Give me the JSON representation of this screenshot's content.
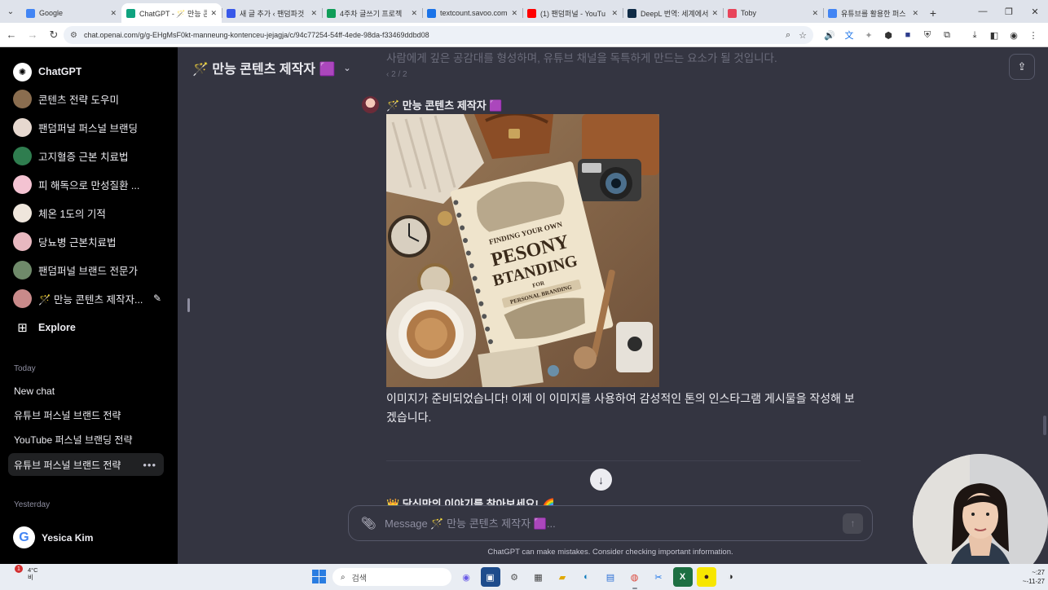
{
  "browser": {
    "tabs": [
      {
        "title": "Google",
        "icon": "google-favicon",
        "color": "#4285f4"
      },
      {
        "title": "ChatGPT - 🪄 만능 콘",
        "icon": "chatgpt-favicon",
        "color": "#10a37f",
        "active": true
      },
      {
        "title": "새 글 추가 ‹ 팬덤파것",
        "icon": "wordpress-favicon",
        "color": "#3858e9"
      },
      {
        "title": "4주차 글쓰기 프로젝",
        "icon": "sheets-favicon",
        "color": "#0f9d58"
      },
      {
        "title": "textcount.savoo.com",
        "icon": "textcount-favicon",
        "color": "#1a73e8"
      },
      {
        "title": "(1) 팬덤퍼널 - YouTu",
        "icon": "youtube-favicon",
        "color": "#ff0000"
      },
      {
        "title": "DeepL 번역: 세계에서",
        "icon": "deepl-favicon",
        "color": "#0f2b46"
      },
      {
        "title": "Toby",
        "icon": "toby-favicon",
        "color": "#e8445a"
      },
      {
        "title": "유튜브를 활용한 퍼스",
        "icon": "docs-favicon",
        "color": "#4285f4"
      }
    ],
    "url": "chat.openai.com/g/g-EHgMsF0kt-manneung-kontenceu-jejagja/c/94c77254-54ff-4ede-98da-f33469ddbd08"
  },
  "sidebar": {
    "gpts": [
      {
        "label": "ChatGPT",
        "icon": "chatgpt-logo-icon",
        "color": "#ffffff",
        "bold": true
      },
      {
        "label": "콘텐츠 전략 도우미",
        "icon": "gpt-avatar-icon",
        "color": "#8a6d4f"
      },
      {
        "label": "팬덤퍼널 퍼스널 브랜딩",
        "icon": "gpt-avatar-icon",
        "color": "#e6d8cf"
      },
      {
        "label": "고지혈증 근본 치료법",
        "icon": "gpt-avatar-icon",
        "color": "#2f7d4f"
      },
      {
        "label": "피 해독으로 만성질환 ...",
        "icon": "gpt-avatar-icon",
        "color": "#f4c3d2"
      },
      {
        "label": "체온 1도의 기적",
        "icon": "gpt-avatar-icon",
        "color": "#efe6dc"
      },
      {
        "label": "당뇨병 근본치료법",
        "icon": "gpt-avatar-icon",
        "color": "#e8b8c0"
      },
      {
        "label": "팬덤퍼널 브랜드 전문가",
        "icon": "gpt-avatar-icon",
        "color": "#6f8a6a"
      },
      {
        "label": "🪄 만능 콘텐츠 제작자...",
        "icon": "gpt-avatar-icon",
        "color": "#c98a8a"
      }
    ],
    "explore_label": "Explore",
    "today_label": "Today",
    "today_chats": [
      {
        "label": "New chat",
        "selected": false
      },
      {
        "label": "유튜브 퍼스널 브랜드 전략",
        "selected": false
      },
      {
        "label": "YouTube 퍼스널 브랜딩 전략",
        "selected": false
      },
      {
        "label": "유튜브 퍼스널 브랜드 전략",
        "selected": true
      }
    ],
    "yesterday_label": "Yesterday",
    "user_name": "Yesica Kim"
  },
  "main": {
    "gpt_title": "🪄 만능 콘텐츠 제작자 🟪",
    "prev_message_tail": "사람에게 깊은 공감대를 형성하며, 유튜브 채널을 독특하게 만드는 요소가 될 것입니다.",
    "pager": "‹ 2 / 2",
    "author": "🪄 만능 콘텐츠 제작자 🟪",
    "image_text": [
      "FINDING YOUR OWN",
      "PESONY",
      "BTANDING",
      "FOR",
      "PERSONAL BRANDING"
    ],
    "message": "이미지가 준비되었습니다! 이제 이 이미지를 사용하여 감성적인 톤의 인스타그램 게시물을 작성해 보겠습니다.",
    "next_message_preview": "👑 당신만의 이야기를 찾아보세요! 🌈",
    "composer_placeholder": "Message 🪄 만능 콘텐츠 제작자 🟪...",
    "disclaimer": "ChatGPT can make mistakes. Consider checking important information."
  },
  "taskbar": {
    "weather_temp": "4°C",
    "weather_desc": "비",
    "weather_badge": "1",
    "search_placeholder": "검색",
    "clock_time": "~:27",
    "clock_date": "~-11-27"
  }
}
